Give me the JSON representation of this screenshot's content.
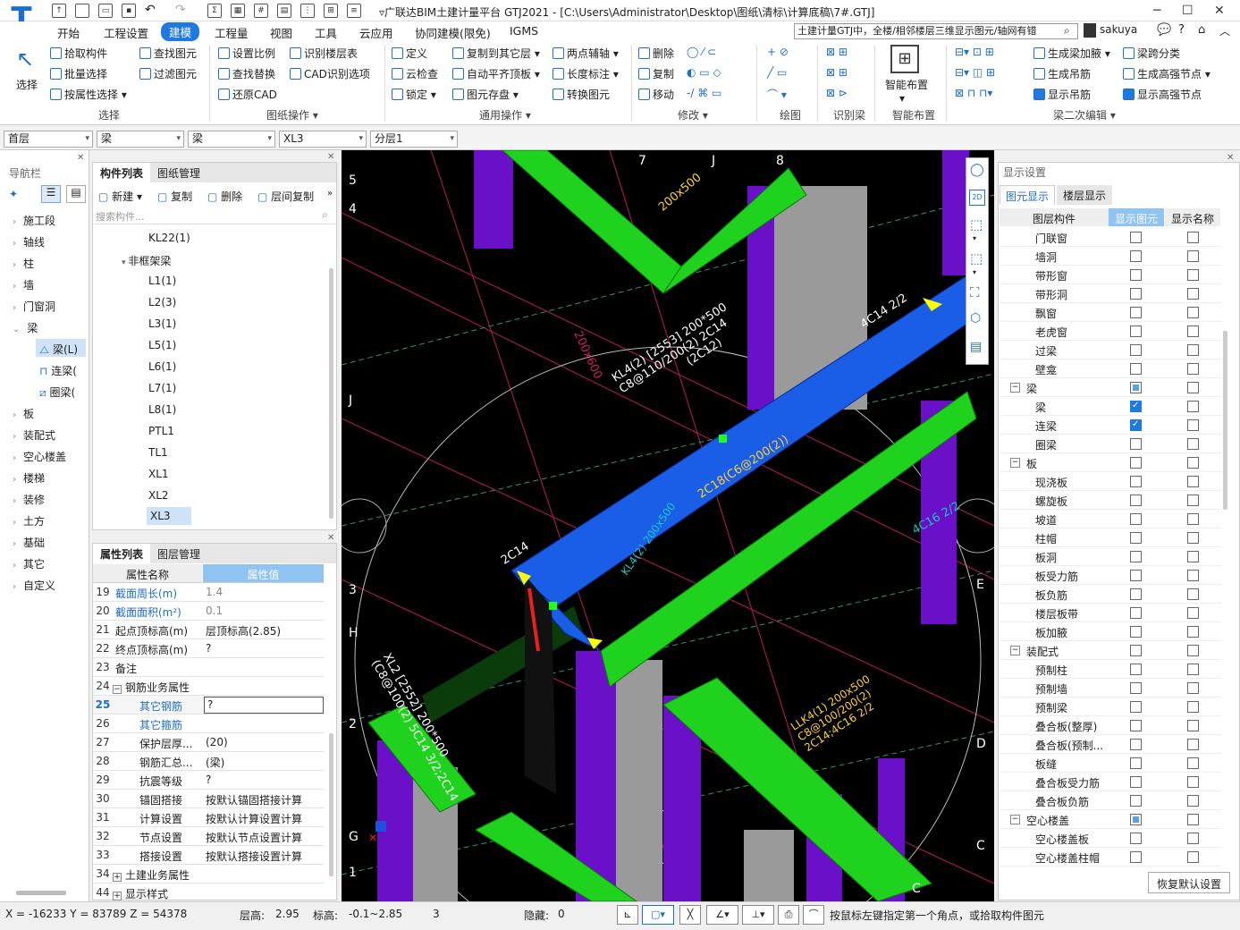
{
  "app": {
    "title": "▿广联达BIM土建计量平台 GTJ2021 - [C:\\Users\\Administrator\\Desktop\\图纸\\清标\\计算底稿\\7#.GTJ]",
    "search_box": "土建计量GTJ中，全楼/相邻楼层三维显示图元/轴网有错",
    "user": "sakuya"
  },
  "menu": [
    "开始",
    "工程设置",
    "建模",
    "工程量",
    "视图",
    "工具",
    "云应用",
    "协同建模(限免)",
    "IGMS"
  ],
  "menu_active": "建模",
  "ribbon": {
    "select_big": "选择",
    "select_items": [
      "拾取构件",
      "批量选择",
      "按属性选择"
    ],
    "select_items2": [
      "查找图元",
      "过滤图元"
    ],
    "select_group": "选择",
    "drawing_items": [
      "设置比例",
      "查找替换",
      "还原CAD"
    ],
    "drawing_items2": [
      "识别楼层表",
      "CAD识别选项"
    ],
    "drawing_group": "图纸操作",
    "general_items": [
      "定义",
      "云检查",
      "锁定"
    ],
    "general_items2": [
      "复制到其它层",
      "自动平齐顶板",
      "图元存盘"
    ],
    "general_items3": [
      "两点辅轴",
      "长度标注",
      "转换图元"
    ],
    "general_group": "通用操作",
    "modify_items": [
      "删除",
      "复制",
      "移动"
    ],
    "modify_group": "修改",
    "draw_group": "绘图",
    "recog_group": "识别梁",
    "smart_big": "智能布置",
    "smart_group": "智能布置",
    "beam_items": [
      "生成梁加腋",
      "生成吊筋",
      "显示吊筋"
    ],
    "beam_items2": [
      "梁跨分类",
      "生成高强节点",
      "显示高强节点"
    ],
    "beam_group": "梁二次编辑"
  },
  "selectors": [
    "首层",
    "梁",
    "梁",
    "XL3",
    "分层1"
  ],
  "nav": {
    "title": "导航栏",
    "items": [
      "施工段",
      "轴线",
      "柱",
      "墙",
      "门窗洞",
      "梁",
      "板",
      "装配式",
      "空心楼盖",
      "楼梯",
      "装修",
      "土方",
      "基础",
      "其它",
      "自定义"
    ],
    "beam_children": [
      "梁(L)",
      "连梁(",
      "圈梁("
    ]
  },
  "components": {
    "tabs": [
      "构件列表",
      "图纸管理"
    ],
    "toolbar": [
      "新建",
      "复制",
      "删除",
      "层间复制"
    ],
    "search_placeholder": "搜索构件...",
    "items": [
      "KL22(1)",
      "非框架梁",
      "L1(1)",
      "L2(3)",
      "L3(1)",
      "L5(1)",
      "L6(1)",
      "L7(1)",
      "L8(1)",
      "PTL1",
      "TL1",
      "XL1",
      "XL2",
      "XL3"
    ],
    "selected": "XL3"
  },
  "properties": {
    "tabs": [
      "属性列表",
      "图层管理"
    ],
    "col_name": "属性名称",
    "col_value": "属性值",
    "rows": [
      {
        "n": "19",
        "k": "截面周长(m)",
        "v": "1.4"
      },
      {
        "n": "20",
        "k": "截面面积(m²)",
        "v": "0.1"
      },
      {
        "n": "21",
        "k": "起点顶标高(m)",
        "v": "层顶标高(2.85)"
      },
      {
        "n": "22",
        "k": "终点顶标高(m)",
        "v": "?"
      },
      {
        "n": "23",
        "k": "备注",
        "v": ""
      },
      {
        "n": "24",
        "k": "钢筋业务属性",
        "v": ""
      },
      {
        "n": "25",
        "k": "其它钢筋",
        "v": "?"
      },
      {
        "n": "26",
        "k": "其它箍筋",
        "v": ""
      },
      {
        "n": "27",
        "k": "保护层厚...",
        "v": "(20)"
      },
      {
        "n": "28",
        "k": "钢筋汇总...",
        "v": "(梁)"
      },
      {
        "n": "29",
        "k": "抗震等级",
        "v": "?"
      },
      {
        "n": "30",
        "k": "锚固搭接",
        "v": "按默认锚固搭接计算"
      },
      {
        "n": "31",
        "k": "计算设置",
        "v": "按默认计算设置计算"
      },
      {
        "n": "32",
        "k": "节点设置",
        "v": "按默认节点设置计算"
      },
      {
        "n": "33",
        "k": "搭接设置",
        "v": "按默认搭接设置计算"
      },
      {
        "n": "34",
        "k": "土建业务属性",
        "v": ""
      },
      {
        "n": "44",
        "k": "显示样式",
        "v": ""
      }
    ]
  },
  "viewport": {
    "labels": [
      "KL4(2) [2553] 200*500",
      "C8@110/200(2) 2C14",
      "(2C12)",
      "2C18(C6@200(2))",
      "XL2 [2552] 200*500",
      "(C8@100(2) 5C14 3/2;2C14",
      "2C14",
      "4C14 2/2",
      "LLK4(1) 200x500",
      "C8@100/200(2)",
      "2C14;4C16 2/2",
      "KL4(2) 200x500",
      "200x500",
      "200x600",
      "4C16 2/2"
    ],
    "axis": [
      "5",
      "4",
      "7",
      "J",
      "8",
      "J",
      "3",
      "H",
      "2",
      "G",
      "1",
      "E",
      "D",
      "C",
      "C"
    ]
  },
  "display": {
    "title": "显示设置",
    "tabs": [
      "图元显示",
      "楼层显示"
    ],
    "col_layer": "图层构件",
    "col_show": "显示图元",
    "col_name": "显示名称",
    "rows": [
      {
        "label": "门联窗",
        "lvl": 2,
        "show": false,
        "name": false
      },
      {
        "label": "墙洞",
        "lvl": 2,
        "show": false,
        "name": false
      },
      {
        "label": "带形窗",
        "lvl": 2,
        "show": false,
        "name": false
      },
      {
        "label": "带形洞",
        "lvl": 2,
        "show": false,
        "name": false
      },
      {
        "label": "飘窗",
        "lvl": 2,
        "show": false,
        "name": false
      },
      {
        "label": "老虎窗",
        "lvl": 2,
        "show": false,
        "name": false
      },
      {
        "label": "过梁",
        "lvl": 2,
        "show": false,
        "name": false
      },
      {
        "label": "壁龛",
        "lvl": 2,
        "show": false,
        "name": false
      },
      {
        "label": "梁",
        "lvl": 1,
        "show": "part",
        "name": false
      },
      {
        "label": "梁",
        "lvl": 2,
        "show": true,
        "name": false
      },
      {
        "label": "连梁",
        "lvl": 2,
        "show": true,
        "name": false
      },
      {
        "label": "圈梁",
        "lvl": 2,
        "show": false,
        "name": false
      },
      {
        "label": "板",
        "lvl": 1,
        "show": false,
        "name": false
      },
      {
        "label": "现浇板",
        "lvl": 2,
        "show": false,
        "name": false
      },
      {
        "label": "螺旋板",
        "lvl": 2,
        "show": false,
        "name": false
      },
      {
        "label": "坡道",
        "lvl": 2,
        "show": false,
        "name": false
      },
      {
        "label": "柱帽",
        "lvl": 2,
        "show": false,
        "name": false
      },
      {
        "label": "板洞",
        "lvl": 2,
        "show": false,
        "name": false
      },
      {
        "label": "板受力筋",
        "lvl": 2,
        "show": false,
        "name": false
      },
      {
        "label": "板负筋",
        "lvl": 2,
        "show": false,
        "name": false
      },
      {
        "label": "楼层板带",
        "lvl": 2,
        "show": false,
        "name": false
      },
      {
        "label": "板加腋",
        "lvl": 2,
        "show": false,
        "name": false
      },
      {
        "label": "装配式",
        "lvl": 1,
        "show": false,
        "name": false
      },
      {
        "label": "预制柱",
        "lvl": 2,
        "show": false,
        "name": false
      },
      {
        "label": "预制墙",
        "lvl": 2,
        "show": false,
        "name": false
      },
      {
        "label": "预制梁",
        "lvl": 2,
        "show": false,
        "name": false
      },
      {
        "label": "叠合板(整厚)",
        "lvl": 2,
        "show": false,
        "name": false
      },
      {
        "label": "叠合板(预制...",
        "lvl": 2,
        "show": false,
        "name": false
      },
      {
        "label": "板缝",
        "lvl": 2,
        "show": false,
        "name": false
      },
      {
        "label": "叠合板受力筋",
        "lvl": 2,
        "show": false,
        "name": false
      },
      {
        "label": "叠合板负筋",
        "lvl": 2,
        "show": false,
        "name": false
      },
      {
        "label": "空心楼盖",
        "lvl": 1,
        "show": "part",
        "name": false
      },
      {
        "label": "空心楼盖板",
        "lvl": 2,
        "show": false,
        "name": false
      },
      {
        "label": "空心楼盖柱帽",
        "lvl": 2,
        "show": false,
        "name": false
      }
    ],
    "reset": "恢复默认设置"
  },
  "status": {
    "coords": "X = -16233 Y = 83789 Z = 54378",
    "floor_h_label": "层高:",
    "floor_h": "2.95",
    "elev_label": "标高:",
    "elev": "-0.1~2.85",
    "count": "3",
    "hidden_label": "隐藏:",
    "hidden": "0",
    "hint": "按鼠标左键指定第一个角点，或拾取构件图元"
  }
}
